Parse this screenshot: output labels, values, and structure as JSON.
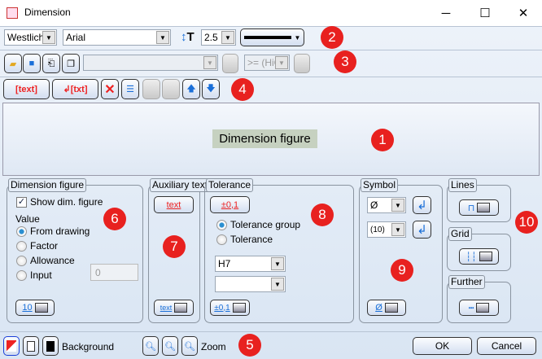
{
  "window": {
    "title": "Dimension",
    "minimize": "─",
    "maximize": "☐",
    "close": "✕"
  },
  "toolbar1": {
    "style": "Westlich",
    "font": "Arial",
    "size": "2.5"
  },
  "toolbar2": {
    "filter": ">= (HiC"
  },
  "toolbar3": {
    "text_button": "[text]",
    "insert_button": "↲[txt]",
    "delete": "✕",
    "up": "🡅",
    "down": "🡇"
  },
  "preview": {
    "label": "Dimension figure"
  },
  "dimension_figure": {
    "title": "Dimension figure",
    "show_label": "Show dim. figure",
    "value_label": "Value",
    "options": [
      "From drawing",
      "Factor",
      "Allowance",
      "Input"
    ],
    "selected": "From drawing",
    "input_value": "0",
    "button_label": "10"
  },
  "auxiliary_text": {
    "title": "Auxiliary text",
    "top_button": "text",
    "bottom_button": "text"
  },
  "tolerance": {
    "title": "Tolerance",
    "top_button": "±0,1",
    "options": [
      "Tolerance group",
      "Tolerance"
    ],
    "selected": "Tolerance group",
    "group_value": "H7",
    "second_value": "",
    "bottom_button": "±0,1"
  },
  "symbol": {
    "title": "Symbol",
    "symbol_value": "Ø",
    "paren_value": "(10)",
    "bottom_button": "Ø"
  },
  "lines": {
    "title": "Lines"
  },
  "grid": {
    "title": "Grid"
  },
  "further": {
    "title": "Further"
  },
  "bottom": {
    "background_label": "Background",
    "zoom_label": "Zoom",
    "ok": "OK",
    "cancel": "Cancel"
  },
  "badges": [
    "1",
    "2",
    "3",
    "4",
    "5",
    "6",
    "7",
    "8",
    "9",
    "10"
  ]
}
